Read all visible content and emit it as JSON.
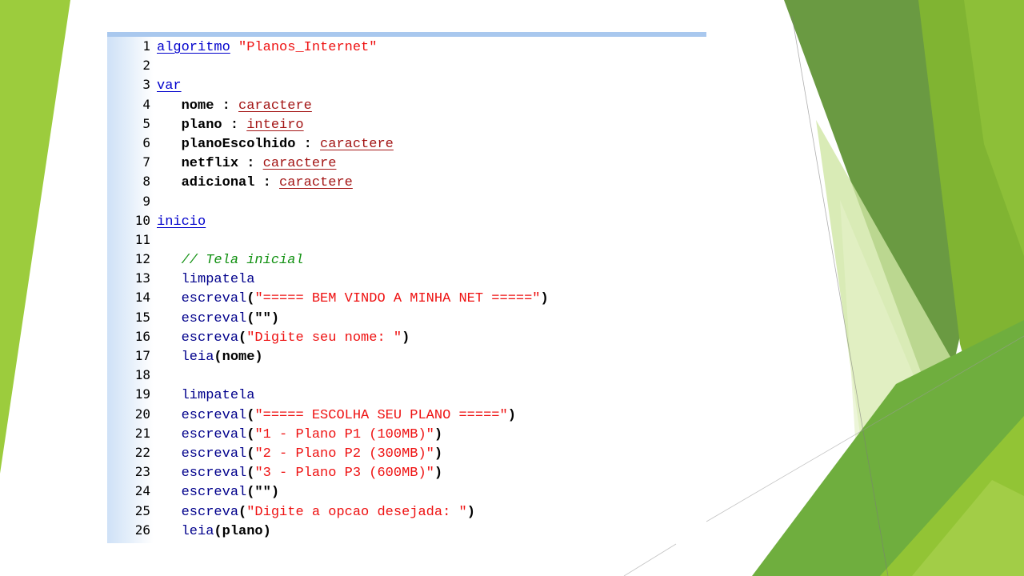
{
  "colors": {
    "keyword": "#0000cc",
    "type": "#a31515",
    "function": "#00008b",
    "string": "#ee1111",
    "comment": "#109010",
    "plain": "#000000",
    "green_light": "#9ccc3d",
    "green_mid": "#76b342",
    "green_dark": "#4a8a2a"
  },
  "editor": {
    "lines": [
      {
        "n": "1",
        "tokens": [
          {
            "t": "kw",
            "v": "algoritmo"
          },
          {
            "t": "plain",
            "v": " "
          },
          {
            "t": "str",
            "v": "\"Planos_Internet\""
          }
        ]
      },
      {
        "n": "2",
        "tokens": []
      },
      {
        "n": "3",
        "tokens": [
          {
            "t": "kw",
            "v": "var"
          }
        ]
      },
      {
        "n": "4",
        "tokens": [
          {
            "t": "plain",
            "v": "   nome : "
          },
          {
            "t": "type",
            "v": "caractere"
          }
        ]
      },
      {
        "n": "5",
        "tokens": [
          {
            "t": "plain",
            "v": "   plano : "
          },
          {
            "t": "type",
            "v": "inteiro"
          }
        ]
      },
      {
        "n": "6",
        "tokens": [
          {
            "t": "plain",
            "v": "   planoEscolhido : "
          },
          {
            "t": "type",
            "v": "caractere"
          }
        ]
      },
      {
        "n": "7",
        "tokens": [
          {
            "t": "plain",
            "v": "   netflix : "
          },
          {
            "t": "type",
            "v": "caractere"
          }
        ]
      },
      {
        "n": "8",
        "tokens": [
          {
            "t": "plain",
            "v": "   adicional : "
          },
          {
            "t": "type",
            "v": "caractere"
          }
        ]
      },
      {
        "n": "9",
        "tokens": []
      },
      {
        "n": "10",
        "tokens": [
          {
            "t": "kw",
            "v": "inicio"
          }
        ]
      },
      {
        "n": "11",
        "tokens": []
      },
      {
        "n": "12",
        "tokens": [
          {
            "t": "plain",
            "v": "   "
          },
          {
            "t": "cmt",
            "v": "// Tela inicial"
          }
        ]
      },
      {
        "n": "13",
        "tokens": [
          {
            "t": "plain",
            "v": "   "
          },
          {
            "t": "fn",
            "v": "limpatela"
          }
        ]
      },
      {
        "n": "14",
        "tokens": [
          {
            "t": "plain",
            "v": "   "
          },
          {
            "t": "fn",
            "v": "escreval"
          },
          {
            "t": "punc",
            "v": "("
          },
          {
            "t": "str",
            "v": "\"===== BEM VINDO A MINHA NET =====\""
          },
          {
            "t": "punc",
            "v": ")"
          }
        ]
      },
      {
        "n": "15",
        "tokens": [
          {
            "t": "plain",
            "v": "   "
          },
          {
            "t": "fn",
            "v": "escreval"
          },
          {
            "t": "punc",
            "v": "(\"\")"
          }
        ]
      },
      {
        "n": "16",
        "tokens": [
          {
            "t": "plain",
            "v": "   "
          },
          {
            "t": "fn",
            "v": "escreva"
          },
          {
            "t": "punc",
            "v": "("
          },
          {
            "t": "str",
            "v": "\"Digite seu nome: \""
          },
          {
            "t": "punc",
            "v": ")"
          }
        ]
      },
      {
        "n": "17",
        "tokens": [
          {
            "t": "plain",
            "v": "   "
          },
          {
            "t": "fn",
            "v": "leia"
          },
          {
            "t": "punc",
            "v": "(nome)"
          }
        ]
      },
      {
        "n": "18",
        "tokens": []
      },
      {
        "n": "19",
        "tokens": [
          {
            "t": "plain",
            "v": "   "
          },
          {
            "t": "fn",
            "v": "limpatela"
          }
        ]
      },
      {
        "n": "20",
        "tokens": [
          {
            "t": "plain",
            "v": "   "
          },
          {
            "t": "fn",
            "v": "escreval"
          },
          {
            "t": "punc",
            "v": "("
          },
          {
            "t": "str",
            "v": "\"===== ESCOLHA SEU PLANO =====\""
          },
          {
            "t": "punc",
            "v": ")"
          }
        ]
      },
      {
        "n": "21",
        "tokens": [
          {
            "t": "plain",
            "v": "   "
          },
          {
            "t": "fn",
            "v": "escreval"
          },
          {
            "t": "punc",
            "v": "("
          },
          {
            "t": "str",
            "v": "\"1 - Plano P1 (100MB)\""
          },
          {
            "t": "punc",
            "v": ")"
          }
        ]
      },
      {
        "n": "22",
        "tokens": [
          {
            "t": "plain",
            "v": "   "
          },
          {
            "t": "fn",
            "v": "escreval"
          },
          {
            "t": "punc",
            "v": "("
          },
          {
            "t": "str",
            "v": "\"2 - Plano P2 (300MB)\""
          },
          {
            "t": "punc",
            "v": ")"
          }
        ]
      },
      {
        "n": "23",
        "tokens": [
          {
            "t": "plain",
            "v": "   "
          },
          {
            "t": "fn",
            "v": "escreval"
          },
          {
            "t": "punc",
            "v": "("
          },
          {
            "t": "str",
            "v": "\"3 - Plano P3 (600MB)\""
          },
          {
            "t": "punc",
            "v": ")"
          }
        ]
      },
      {
        "n": "24",
        "tokens": [
          {
            "t": "plain",
            "v": "   "
          },
          {
            "t": "fn",
            "v": "escreval"
          },
          {
            "t": "punc",
            "v": "(\"\")"
          }
        ]
      },
      {
        "n": "25",
        "tokens": [
          {
            "t": "plain",
            "v": "   "
          },
          {
            "t": "fn",
            "v": "escreva"
          },
          {
            "t": "punc",
            "v": "("
          },
          {
            "t": "str",
            "v": "\"Digite a opcao desejada: \""
          },
          {
            "t": "punc",
            "v": ")"
          }
        ]
      },
      {
        "n": "26",
        "tokens": [
          {
            "t": "plain",
            "v": "   "
          },
          {
            "t": "fn",
            "v": "leia"
          },
          {
            "t": "punc",
            "v": "(plano)"
          }
        ]
      }
    ]
  }
}
